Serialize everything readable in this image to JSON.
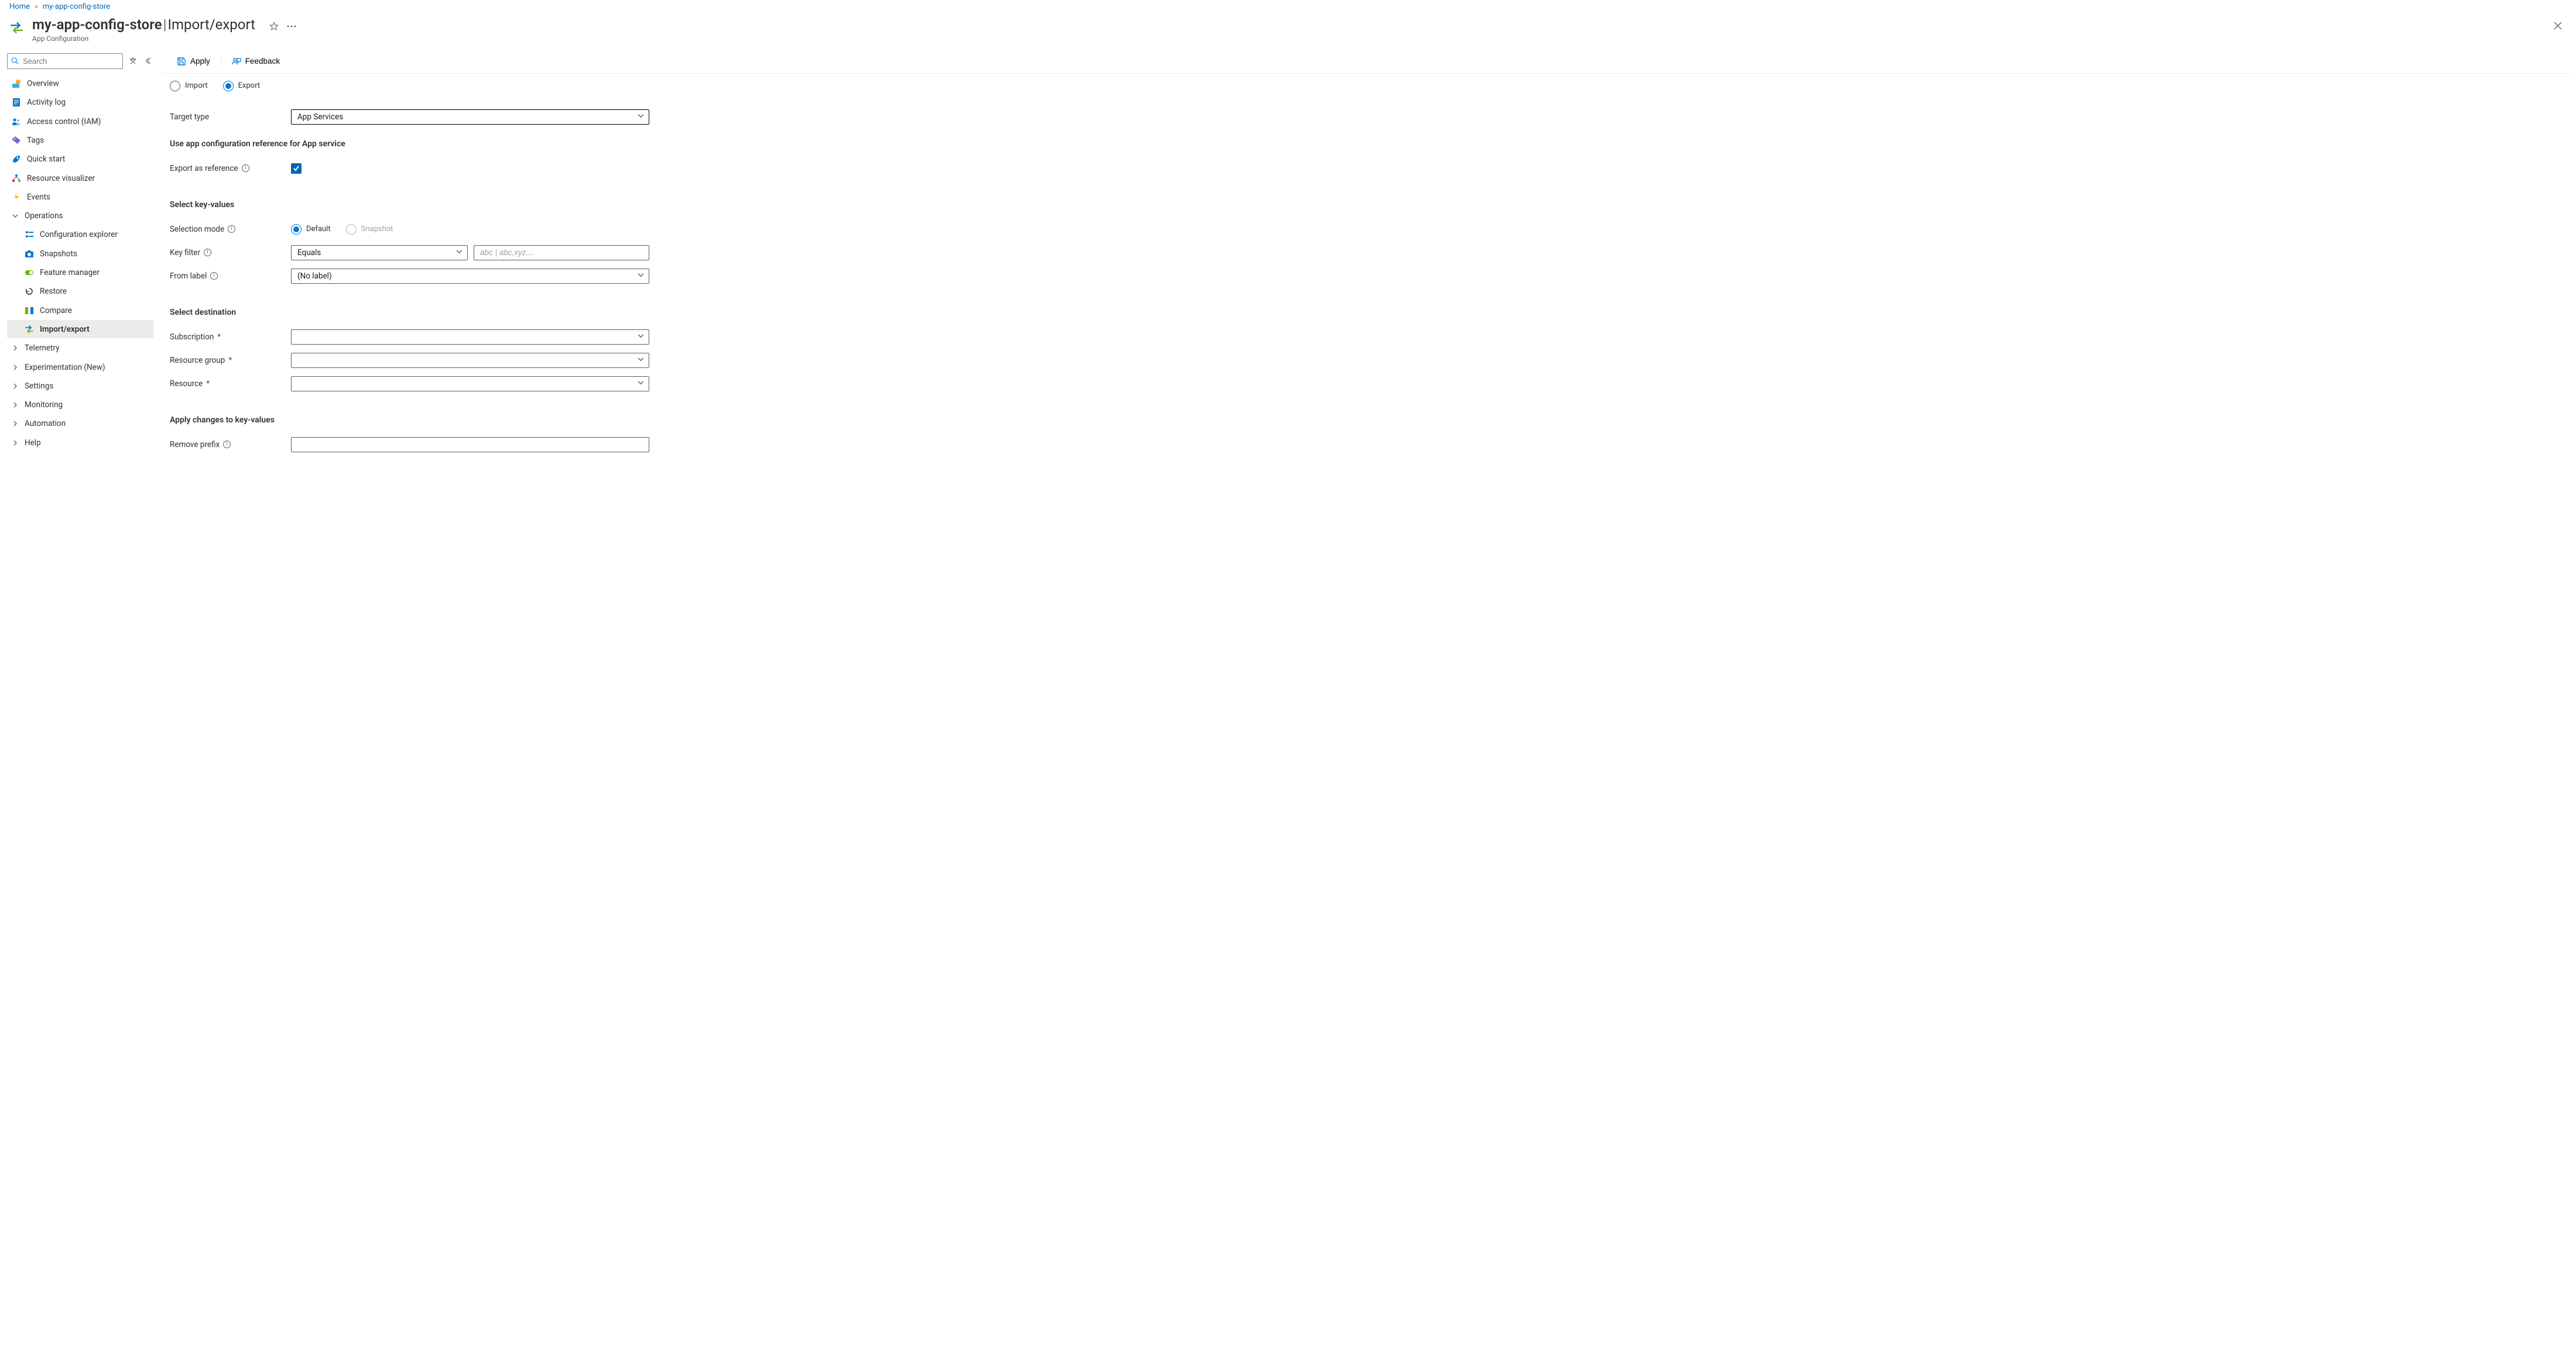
{
  "breadcrumb": {
    "home": "Home",
    "current": "my-app-config-store"
  },
  "header": {
    "resource_name": "my-app-config-store",
    "page_name": "Import/export",
    "service_label": "App Configuration"
  },
  "sidebar": {
    "search_placeholder": "Search",
    "items": {
      "overview": "Overview",
      "activity": "Activity log",
      "iam": "Access control (IAM)",
      "tags": "Tags",
      "quickstart": "Quick start",
      "resviz": "Resource visualizer",
      "events": "Events",
      "operations": "Operations",
      "configexplorer": "Configuration explorer",
      "snapshots": "Snapshots",
      "featuremgr": "Feature manager",
      "restore": "Restore",
      "compare": "Compare",
      "importexport": "Import/export",
      "telemetry": "Telemetry",
      "experimentation": "Experimentation (New)",
      "settings": "Settings",
      "monitoring": "Monitoring",
      "automation": "Automation",
      "help": "Help"
    }
  },
  "cmdbar": {
    "apply": "Apply",
    "feedback": "Feedback"
  },
  "form": {
    "import_label": "Import",
    "export_label": "Export",
    "target_type_label": "Target type",
    "target_type_value": "App Services",
    "section_reference": "Use app configuration reference for App service",
    "export_as_ref_label": "Export as reference",
    "section_keyvalues": "Select key-values",
    "selection_mode_label": "Selection mode",
    "selection_default": "Default",
    "selection_snapshot": "Snapshot",
    "key_filter_label": "Key filter",
    "key_filter_op": "Equals",
    "key_filter_placeholder": "abc | abc,xyz,...",
    "from_label_label": "From label",
    "from_label_value": "(No label)",
    "section_destination": "Select destination",
    "subscription_label": "Subscription",
    "resource_group_label": "Resource group",
    "resource_label": "Resource",
    "section_apply_changes": "Apply changes to key-values",
    "remove_prefix_label": "Remove prefix"
  }
}
